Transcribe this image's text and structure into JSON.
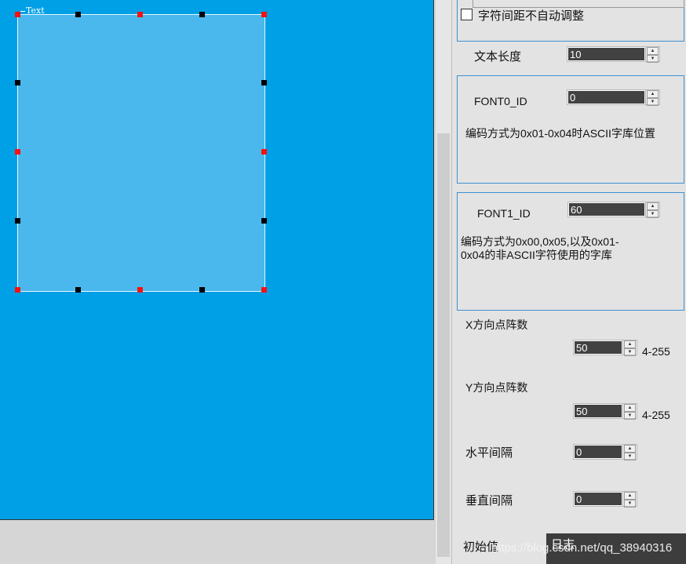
{
  "canvas": {
    "widget_label": "Text",
    "widget_color": "#4ab8ec",
    "background_color": "#00a0e6"
  },
  "panel": {
    "letter_spacing_checkbox": {
      "label": "字符间距不自动调整",
      "checked": false
    },
    "text_length": {
      "label": "文本长度",
      "value": "10"
    },
    "font0": {
      "label": "FONT0_ID",
      "value": "0",
      "description": "编码方式为0x01-0x04时ASCII字库位置"
    },
    "font1": {
      "label": "FONT1_ID",
      "value": "60",
      "description": "编码方式为0x00,0x05,以及0x01-0x04的非ASCII字符使用的字库"
    },
    "x_dots": {
      "label": "X方向点阵数",
      "value": "50",
      "range": "4-255"
    },
    "y_dots": {
      "label": "Y方向点阵数",
      "value": "50",
      "range": "4-255"
    },
    "h_spacing": {
      "label": "水平间隔",
      "value": "0"
    },
    "v_spacing": {
      "label": "垂直间隔",
      "value": "0"
    },
    "initial_value": {
      "label": "初始值"
    }
  },
  "log_button": {
    "label": "日志"
  },
  "watermark": "https://blog.csdn.net/qq_38940316",
  "icons": {
    "spin_up": "▲",
    "spin_down": "▼"
  }
}
